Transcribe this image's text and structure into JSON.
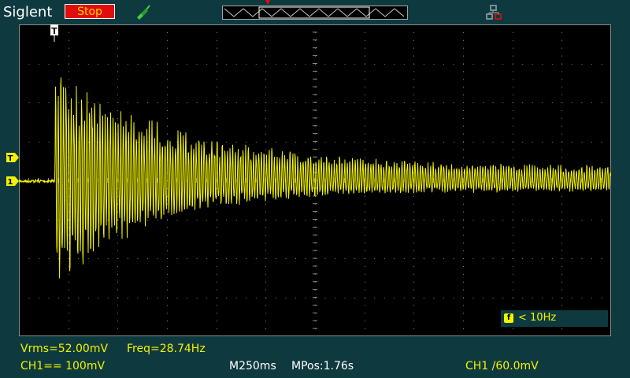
{
  "header": {
    "brand": "Siglent",
    "run_state": "Stop"
  },
  "icons": {
    "probe": "probe-icon",
    "network": "network-icon",
    "trigger_marker": "trigger-marker-icon",
    "channel_marker": "channel-marker-icon"
  },
  "colors": {
    "background": "#0e3a3f",
    "screen": "#000000",
    "trace": "#f2f200",
    "stop": "#e10c0c",
    "grid": "#c8c8c8"
  },
  "screen": {
    "filter_label": "f",
    "filter_text": "< 10Hz"
  },
  "measurements": {
    "vrms": "Vrms=52.00mV",
    "freq": "Freq=28.74Hz"
  },
  "status_bar": {
    "ch1_scale": "CH1== 100mV",
    "timebase": "M250ms",
    "mpos": "MPos:1.76s",
    "trigger": "CH1 /60.0mV"
  },
  "markers": {
    "trigger_level": "T",
    "channel": "1"
  }
}
